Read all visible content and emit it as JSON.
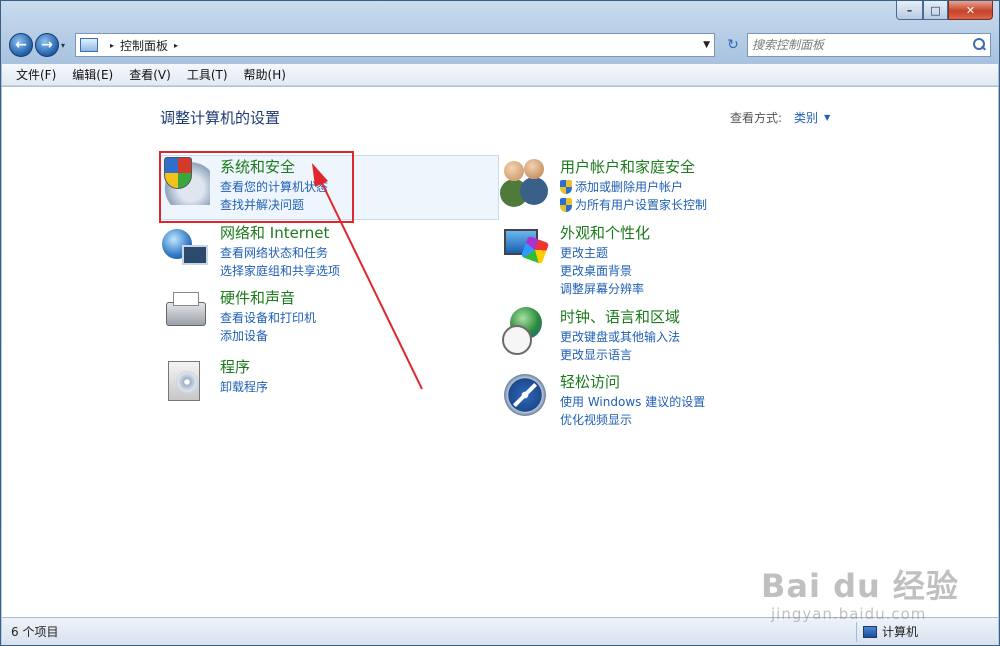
{
  "window": {
    "caption": {
      "minimize": "–",
      "maximize": "□",
      "close": "✕"
    }
  },
  "nav": {
    "back": "←",
    "forward": "→",
    "recent_dropdown": "▾",
    "breadcrumb_root_arrow": "▸",
    "breadcrumb": "控制面板",
    "breadcrumb_arrow": "▸",
    "address_dropdown": "▼",
    "refresh": "↻",
    "search_placeholder": "搜索控制面板"
  },
  "menu": {
    "items": [
      "文件(F)",
      "编辑(E)",
      "查看(V)",
      "工具(T)",
      "帮助(H)"
    ]
  },
  "content": {
    "title": "调整计算机的设置",
    "view_by_label": "查看方式:",
    "view_by_value": "类别",
    "view_by_arrow": "▼",
    "left_categories": [
      {
        "title": "系统和安全",
        "icon": "security-shield-icon",
        "links": [
          "查看您的计算机状态",
          "查找并解决问题"
        ]
      },
      {
        "title": "网络和 Internet",
        "icon": "network-globe-icon",
        "links": [
          "查看网络状态和任务",
          "选择家庭组和共享选项"
        ]
      },
      {
        "title": "硬件和声音",
        "icon": "printer-icon",
        "links": [
          "查看设备和打印机",
          "添加设备"
        ]
      },
      {
        "title": "程序",
        "icon": "programs-icon",
        "links": [
          "卸载程序"
        ]
      }
    ],
    "right_categories": [
      {
        "title": "用户帐户和家庭安全",
        "icon": "users-icon",
        "links": [
          "添加或删除用户帐户",
          "为所有用户设置家长控制"
        ]
      },
      {
        "title": "外观和个性化",
        "icon": "appearance-icon",
        "links": [
          "更改主题",
          "更改桌面背景",
          "调整屏幕分辨率"
        ]
      },
      {
        "title": "时钟、语言和区域",
        "icon": "clock-globe-icon",
        "links": [
          "更改键盘或其他输入法",
          "更改显示语言"
        ]
      },
      {
        "title": "轻松访问",
        "icon": "ease-of-access-icon",
        "links": [
          "使用 Windows 建议的设置",
          "优化视频显示"
        ]
      }
    ]
  },
  "status": {
    "count": "6 个项目",
    "computer": "计算机"
  },
  "watermark": {
    "brand": "Bai du 经验",
    "url": "jingyan.baidu.com"
  },
  "colors": {
    "category_title": "#1b7a1b",
    "link": "#1f5fb5",
    "annotation_red": "#e0262b"
  }
}
